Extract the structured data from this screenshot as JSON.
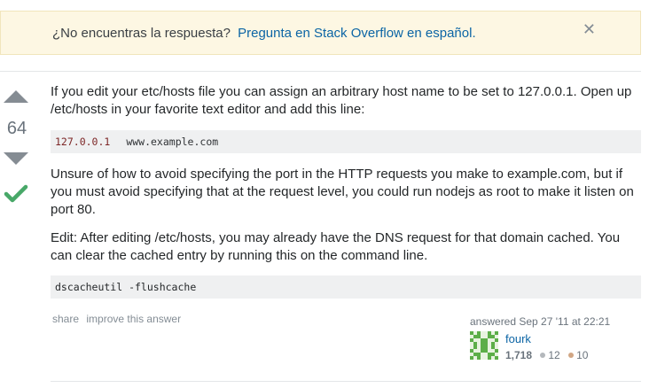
{
  "banner": {
    "text": "¿No encuentras la respuesta?",
    "link": "Pregunta en Stack Overflow en español.",
    "close_icon": "close-icon",
    "background": "#fdf7e3"
  },
  "vote": {
    "count": "64",
    "up_icon": "arrow-up-icon",
    "down_icon": "arrow-down-icon",
    "accepted_icon": "checkmark-icon",
    "accepted_color": "#48a868"
  },
  "answer": {
    "paragraph1": "If you edit your etc/hosts file you can assign an arbitrary host name to be set to 127.0.0.1. Open up /etc/hosts in your favorite text editor and add this line:",
    "code1_ip": "127.0.0.1",
    "code1_host": "www.example.com",
    "paragraph2": "Unsure of how to avoid specifying the port in the HTTP requests you make to example.com, but if you must avoid specifying that at the request level, you could run nodejs as root to make it listen on port 80.",
    "paragraph3": "Edit: After editing /etc/hosts, you may already have the DNS request for that domain cached. You can clear the cached entry by running this on the command line.",
    "code2": "dscacheutil -flushcache"
  },
  "actions": {
    "share": "share",
    "improve": "improve this answer"
  },
  "user": {
    "answered_label": "answered",
    "answered_time": "Sep 27 '11 at 22:21",
    "name": "fourk",
    "reputation": "1,718",
    "silver": "12",
    "bronze": "10"
  }
}
